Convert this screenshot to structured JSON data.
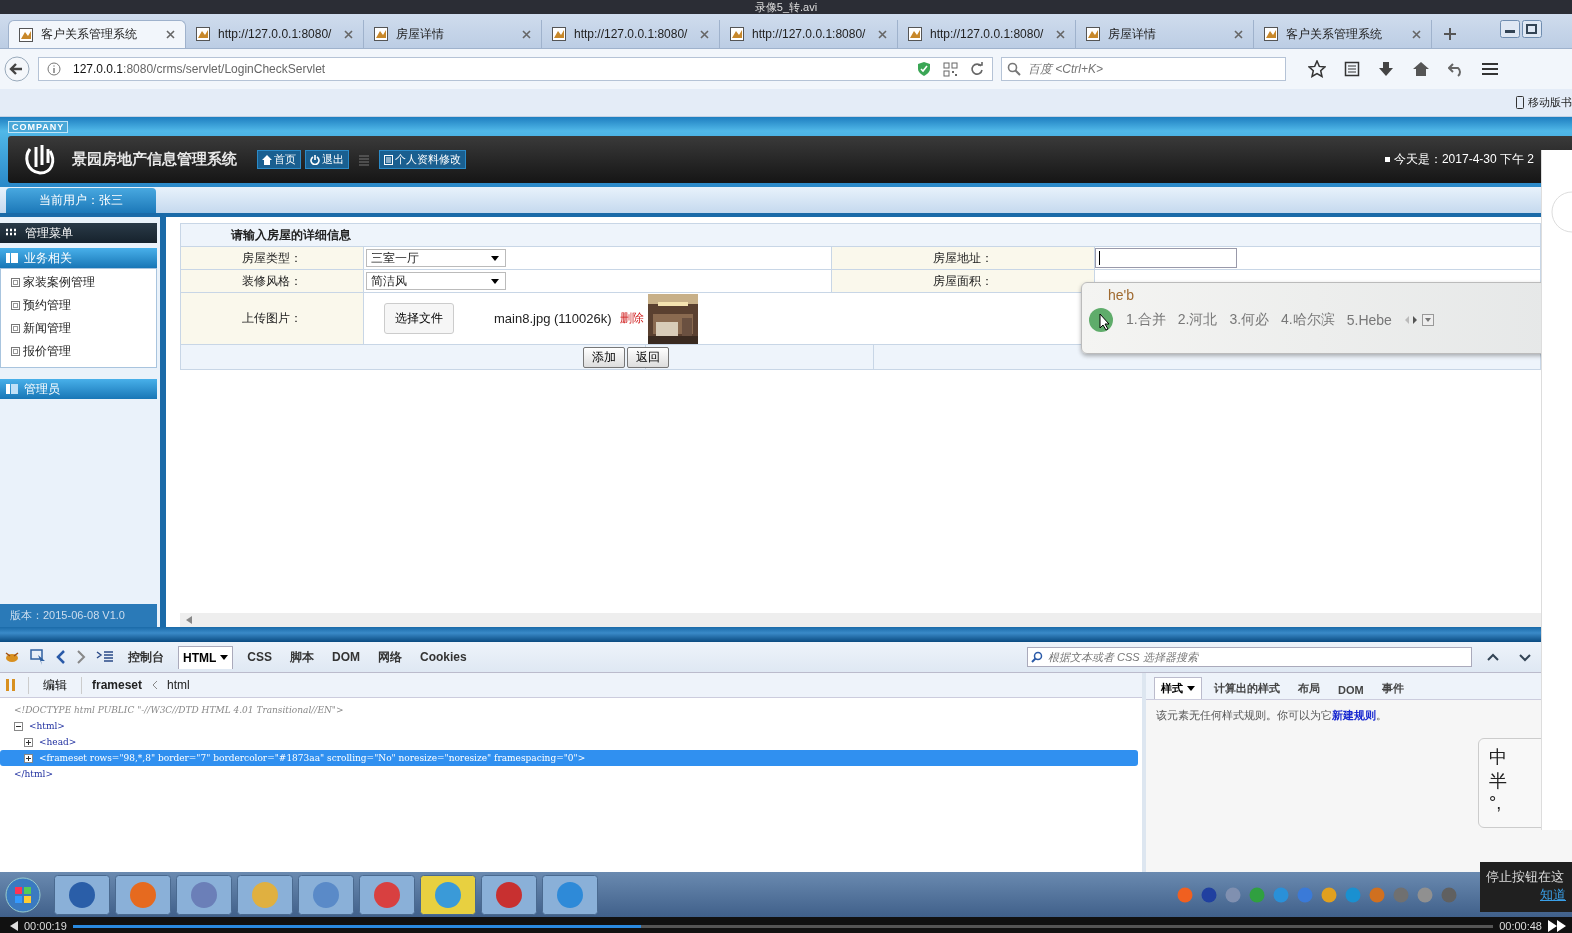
{
  "player": {
    "title": "录像5_转.avi",
    "elapsed": "00:00:19",
    "total": "00:00:48",
    "level": 0.4
  },
  "browser": {
    "tabs": [
      {
        "title": "客户关系管理系统",
        "selected": true
      },
      {
        "title": "http://127.0.0.1:8080/",
        "selected": false
      },
      {
        "title": "房屋详情",
        "selected": false
      },
      {
        "title": "http://127.0.0.1:8080/",
        "selected": false
      },
      {
        "title": "http://127.0.0.1:8080/",
        "selected": false
      },
      {
        "title": "http://127.0.0.1:8080/",
        "selected": false
      },
      {
        "title": "房屋详情",
        "selected": false
      },
      {
        "title": "客户关系管理系统",
        "selected": false
      }
    ],
    "address_host": "127.0.0.1",
    "address_rest": ":8080/crms/servlet/LoginCheckServlet",
    "search_placeholder": "百度 <Ctrl+K>",
    "bookmark": "移动版书"
  },
  "site": {
    "company": "COMPANY",
    "title": "景园房地产信息管理系统",
    "nav": [
      {
        "label": "首页",
        "kind": "home"
      },
      {
        "label": "退出",
        "kind": "power"
      },
      {
        "label": "个人资料修改",
        "kind": "doc"
      }
    ],
    "date": "今天是：2017-4-30 下午 2",
    "user": "当前用户：张三"
  },
  "sidebar": {
    "title": "管理菜单",
    "groups": [
      {
        "label": "业务相关",
        "expanded": true,
        "items": [
          "家装案例管理",
          "预约管理",
          "新闻管理",
          "报价管理"
        ]
      },
      {
        "label": "管理员",
        "expanded": false
      }
    ],
    "version": "版本：2015-06-08 V1.0"
  },
  "form": {
    "heading": "请输入房屋的详细信息",
    "type_label": "房屋类型：",
    "type_value": "三室一厅",
    "address_label": "房屋地址：",
    "style_label": "装修风格：",
    "style_value": "简洁风",
    "area_label": "房屋面积：",
    "upload_label": "上传图片：",
    "choose_button": "选择文件",
    "file_name": "main8.jpg (110026k)",
    "delete_link": "删除",
    "buttons": [
      "添加",
      "返回"
    ]
  },
  "ime": {
    "input": "he'b",
    "candidates": [
      "1.合并",
      "2.河北",
      "3.何必",
      "4.哈尔滨",
      "5.Hebe"
    ],
    "status": [
      "中",
      "半",
      "°,"
    ]
  },
  "devtools": {
    "tabs": [
      {
        "label": "控制台",
        "selected": false
      },
      {
        "label": "HTML",
        "selected": true
      },
      {
        "label": "CSS",
        "selected": false
      },
      {
        "label": "脚本",
        "selected": false
      },
      {
        "label": "DOM",
        "selected": false
      },
      {
        "label": "网络",
        "selected": false
      },
      {
        "label": "Cookies",
        "selected": false
      }
    ],
    "search_placeholder": "根据文本或者 CSS 选择器搜索",
    "edit": "编辑",
    "crumbs": [
      "frameset",
      "html"
    ],
    "tree": [
      {
        "text": "<!DOCTYPE html PUBLIC \"-//W3C//DTD HTML 4.01 Transitional//EN\">",
        "kind": "comment"
      },
      {
        "text": "<html>",
        "kind": "element",
        "expanded": true,
        "selected": false,
        "closing": "</html>",
        "children": [
          {
            "text": "<head>",
            "kind": "element",
            "expanded": false,
            "selected": false
          },
          {
            "text": "<frameset rows=\"98,*,8\" border=\"7\" bordercolor=\"#1873aa\" scrolling=\"No\" noresize=\"noresize\" framespacing=\"0\">",
            "kind": "element",
            "expanded": false,
            "selected": true
          }
        ]
      }
    ],
    "side_tabs": [
      {
        "label": "样式",
        "selected": true
      },
      {
        "label": "计算出的样式",
        "selected": false
      },
      {
        "label": "布局",
        "selected": false
      },
      {
        "label": "DOM",
        "selected": false
      },
      {
        "label": "事件",
        "selected": false
      }
    ],
    "message_before": "该元素无任何样式规则。你可以为它",
    "message_link": "新建规则",
    "message_after": "。"
  },
  "toast": {
    "line1": "停止按钮在这",
    "link": "知道"
  }
}
